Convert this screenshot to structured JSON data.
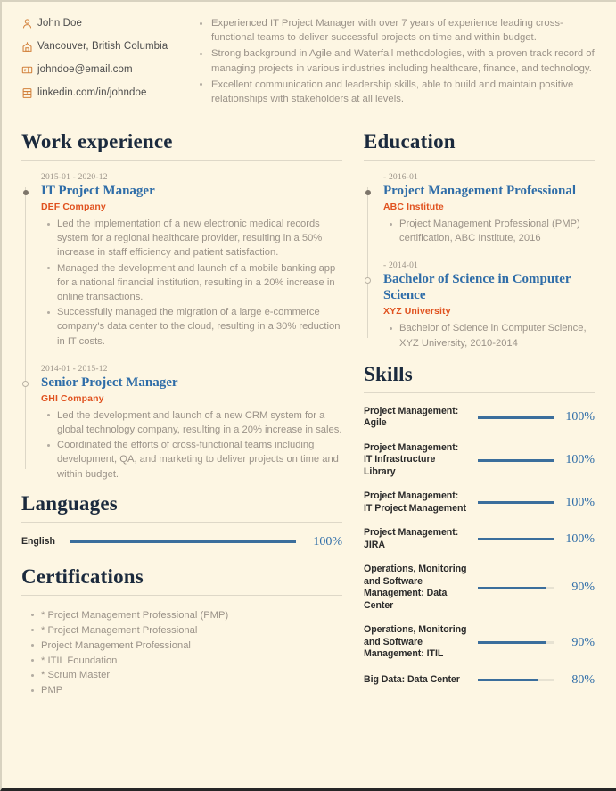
{
  "theme": {
    "background": "#fdf6e3",
    "heading_color": "#1b2a3d",
    "title_color": "#2f6da8",
    "org_color": "#e0521f",
    "body_color": "#9a9288",
    "icon_color": "#d2813c",
    "bar_color": "#3b6e9c",
    "bar_track_color": "#e7e2d2"
  },
  "contact": {
    "items": [
      {
        "icon": "person-icon",
        "text": "John Doe"
      },
      {
        "icon": "location-icon",
        "text": "Vancouver, British Columbia"
      },
      {
        "icon": "email-icon",
        "text": "johndoe@email.com"
      },
      {
        "icon": "linkedin-icon",
        "text": "linkedin.com/in/johndoe"
      }
    ]
  },
  "summary": {
    "points": [
      "Experienced IT Project Manager with over 7 years of experience leading cross-functional teams to deliver successful projects on time and within budget.",
      "Strong background in Agile and Waterfall methodologies, with a proven track record of managing projects in various industries including healthcare, finance, and technology.",
      "Excellent communication and leadership skills, able to build and maintain positive relationships with stakeholders at all levels."
    ]
  },
  "work_experience": {
    "title": "Work experience",
    "entries": [
      {
        "date": "2015-01 - 2020-12",
        "title": "IT Project Manager",
        "organization": "DEF Company",
        "marker": "filled",
        "points": [
          "Led the implementation of a new electronic medical records system for a regional healthcare provider, resulting in a 50% increase in staff efficiency and patient satisfaction.",
          "Managed the development and launch of a mobile banking app for a national financial institution, resulting in a 20% increase in online transactions.",
          "Successfully managed the migration of a large e-commerce company's data center to the cloud, resulting in a 30% reduction in IT costs."
        ]
      },
      {
        "date": "2014-01 - 2015-12",
        "title": "Senior Project Manager",
        "organization": "GHI Company",
        "marker": "hollow",
        "points": [
          "Led the development and launch of a new CRM system for a global technology company, resulting in a 20% increase in sales.",
          "Coordinated the efforts of cross-functional teams including development, QA, and marketing to deliver projects on time and within budget."
        ]
      }
    ]
  },
  "languages": {
    "title": "Languages",
    "items": [
      {
        "label": "English",
        "percent": 100,
        "percent_label": "100%"
      }
    ]
  },
  "certifications": {
    "title": "Certifications",
    "items": [
      "* Project Management Professional (PMP)",
      "* Project Management Professional",
      "Project Management Professional",
      "* ITIL Foundation",
      "* Scrum Master",
      "PMP"
    ]
  },
  "education": {
    "title": "Education",
    "entries": [
      {
        "date": "- 2016-01",
        "title": "Project Management Professional",
        "organization": "ABC Institute",
        "marker": "filled",
        "points": [
          "Project Management Professional (PMP) certification, ABC Institute, 2016"
        ]
      },
      {
        "date": "- 2014-01",
        "title": "Bachelor of Science in Computer Science",
        "organization": "XYZ University",
        "marker": "hollow",
        "points": [
          "Bachelor of Science in Computer Science, XYZ University, 2010-2014"
        ]
      }
    ]
  },
  "skills": {
    "title": "Skills",
    "items": [
      {
        "label": "Project Management: Agile",
        "percent": 100,
        "percent_label": "100%"
      },
      {
        "label": "Project Management: IT Infrastructure Library",
        "percent": 100,
        "percent_label": "100%"
      },
      {
        "label": "Project Management: IT Project Management",
        "percent": 100,
        "percent_label": "100%"
      },
      {
        "label": "Project Management: JIRA",
        "percent": 100,
        "percent_label": "100%"
      },
      {
        "label": "Operations, Monitoring and Software Management: Data Center",
        "percent": 90,
        "percent_label": "90%"
      },
      {
        "label": "Operations, Monitoring and Software Management: ITIL",
        "percent": 90,
        "percent_label": "90%"
      },
      {
        "label": "Big Data: Data Center",
        "percent": 80,
        "percent_label": "80%"
      }
    ]
  }
}
